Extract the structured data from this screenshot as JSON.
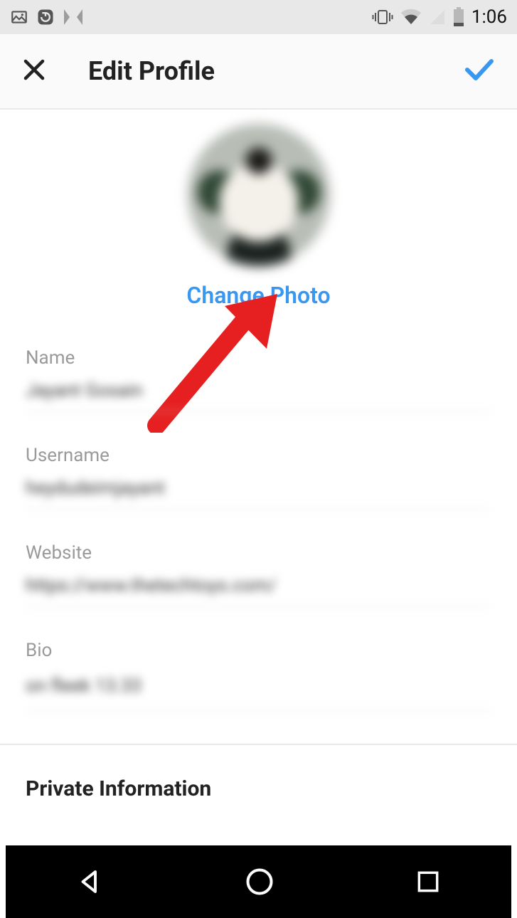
{
  "status_bar": {
    "time": "1:06"
  },
  "header": {
    "title": "Edit Profile"
  },
  "photo": {
    "change_label": "Change Photo"
  },
  "fields": {
    "name": {
      "label": "Name",
      "value": "Jayant Gosain"
    },
    "username": {
      "label": "Username",
      "value": "heydudeimjayant"
    },
    "website": {
      "label": "Website",
      "value": "https://www.thetechtoys.com/"
    },
    "bio": {
      "label": "Bio",
      "value": "on fleek\n13.33"
    }
  },
  "sections": {
    "private_info": "Private Information"
  },
  "colors": {
    "accent": "#3897f0",
    "label": "#9a9a9a",
    "text": "#222222"
  }
}
